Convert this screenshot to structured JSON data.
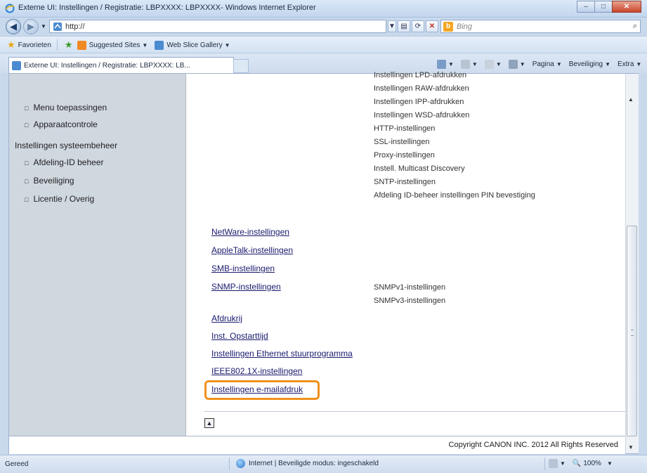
{
  "window": {
    "title": "Externe UI: Instellingen / Registratie: LBPXXXX: LBPXXXX- Windows Internet Explorer",
    "buttons": [
      "–",
      "□",
      "✕"
    ]
  },
  "address_bar": {
    "url": "http://",
    "search_placeholder": "Bing"
  },
  "favorites_bar": {
    "favorites_label": "Favorieten",
    "items": [
      "Suggested Sites",
      "Web Slice Gallery"
    ]
  },
  "tab": {
    "label": "Externe UI: Instellingen / Registratie: LBPXXXX: LB..."
  },
  "command_bar": {
    "page": "Pagina",
    "security": "Beveiliging",
    "extra": "Extra"
  },
  "sidebar": {
    "items": [
      {
        "label": "Menu toepassingen",
        "sub": true
      },
      {
        "label": "Apparaatcontrole",
        "sub": true
      },
      {
        "label": "Instellingen systeembeheer",
        "sub": false
      },
      {
        "label": "Afdeling-ID beheer",
        "sub": true
      },
      {
        "label": "Beveiliging",
        "sub": true
      },
      {
        "label": "Licentie / Overig",
        "sub": true
      }
    ]
  },
  "main": {
    "sub_settings": [
      "Instellingen LPD-afdrukken",
      "Instellingen RAW-afdrukken",
      "Instellingen IPP-afdrukken",
      "Instellingen WSD-afdrukken",
      "HTTP-instellingen",
      "SSL-instellingen",
      "Proxy-instellingen",
      "Instell. Multicast Discovery",
      "SNTP-instellingen",
      "Afdeling ID-beheer instellingen PIN bevestiging"
    ],
    "links": [
      "NetWare-instellingen",
      "AppleTalk-instellingen",
      "SMB-instellingen",
      "SNMP-instellingen",
      "Afdrukrij",
      "Inst. Opstarttijd",
      "Instellingen Ethernet stuurprogramma",
      "IEEE802.1X-instellingen",
      "Instellingen e-mailafdruk"
    ],
    "snmp_sub": [
      "SNMPv1-instellingen",
      "SNMPv3-instellingen"
    ],
    "top_button": "▲",
    "copyright": "Copyright CANON INC. 2012 All Rights Reserved"
  },
  "status_bar": {
    "status": "Gereed",
    "zone": "Internet | Beveiligde modus: ingeschakeld",
    "zoom": "100%"
  },
  "colors": {
    "highlight": "#f0921c",
    "link": "#1a1a6e",
    "sidebar_bg": "#cfd7df"
  }
}
